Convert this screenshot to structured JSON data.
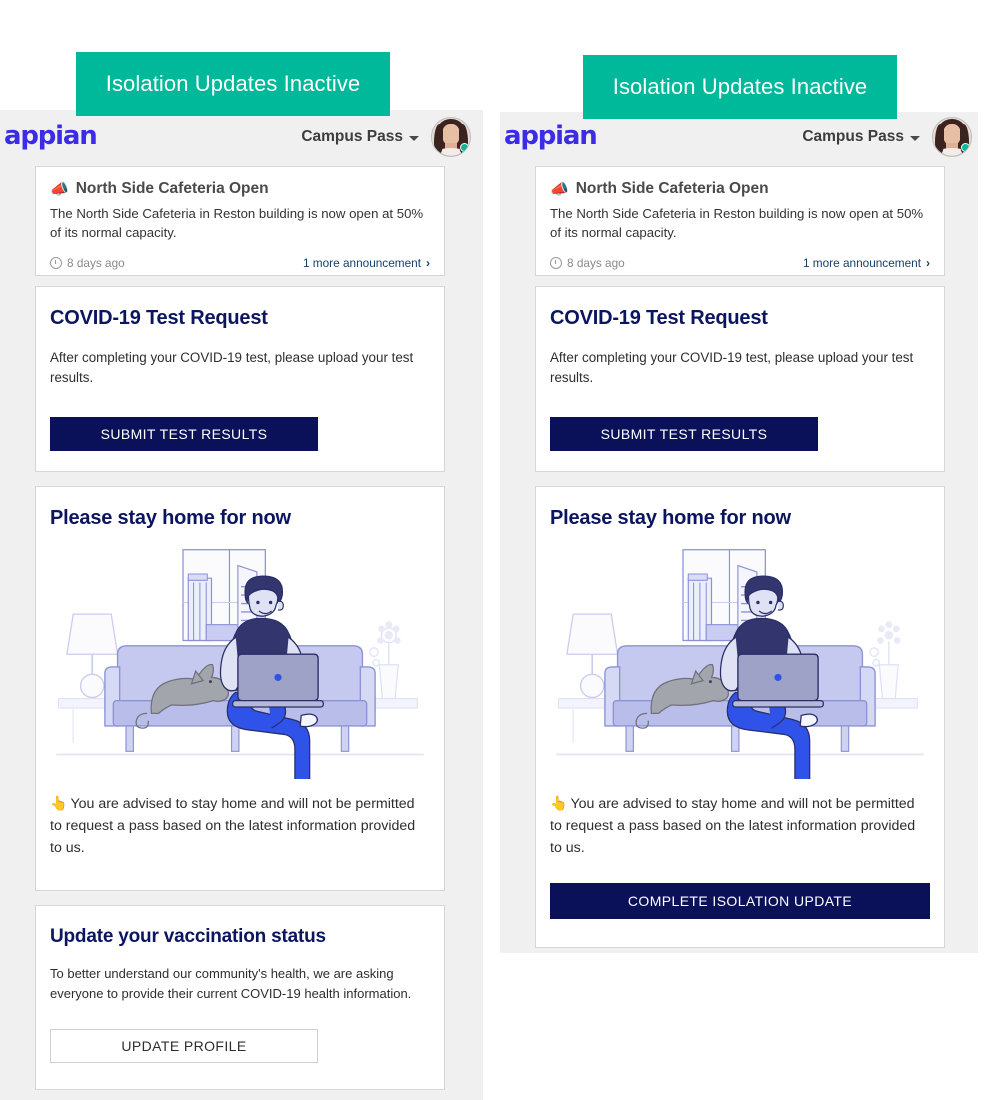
{
  "banner": {
    "label": "Isolation Updates Inactive",
    "color": "#00b89a"
  },
  "header": {
    "logo": "appian",
    "nav_label": "Campus Pass",
    "caret_icon": "chevron-down-icon",
    "avatar_icon": "user-avatar",
    "status_dot_color": "#00b89a"
  },
  "announcement": {
    "icon": "megaphone-icon",
    "title": "North Side Cafeteria Open",
    "body": "The North Side Cafeteria in Reston building is now open at 50% of its normal capacity.",
    "time_icon": "clock-icon",
    "time": "8 days ago",
    "more_label": "1 more announcement",
    "more_icon": "chevron-right-icon"
  },
  "test_request": {
    "title": "COVID-19 Test Request",
    "body": "After completing your COVID-19 test, please upload your test results.",
    "button": "SUBMIT TEST RESULTS"
  },
  "stay_home": {
    "title": "Please stay home for now",
    "illustration": "person-on-couch-with-laptop-and-dog-illustration",
    "advisory_icon": "pointing-hand-icon",
    "advisory": "You are advised to stay home and will not be permitted to request a pass based on the latest information provided to us.",
    "button": "COMPLETE ISOLATION UPDATE"
  },
  "vaccination": {
    "title": "Update your vaccination status",
    "body": "To better understand our community's health, we are asking everyone to provide their current COVID-19 health information.",
    "button": "UPDATE PROFILE"
  },
  "colors": {
    "navy": "#0a1158",
    "teal": "#00b89a",
    "logo_blue": "#3c2ce6",
    "panel_bg": "#f0f0f0",
    "link": "#17406b"
  }
}
